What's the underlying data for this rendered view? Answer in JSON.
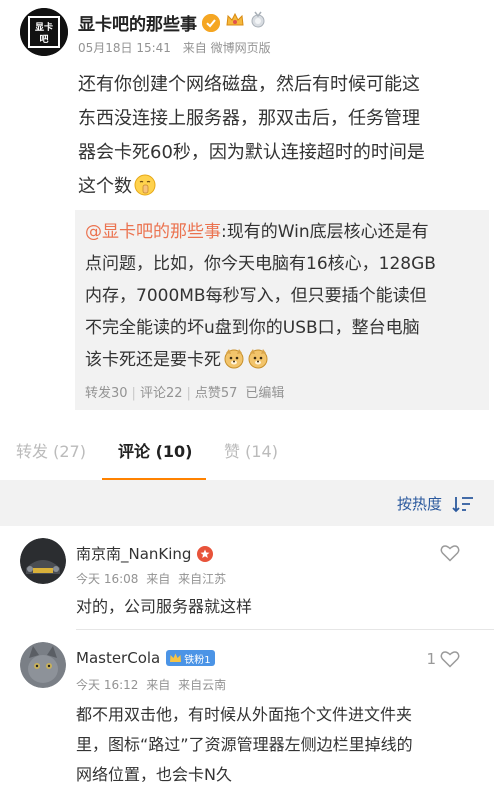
{
  "post": {
    "author": "显卡吧的那些事",
    "avatar_text": "显卡吧",
    "date": "05月18日 15:41",
    "source": "来自 微博网页版",
    "text_lines": [
      "还有你创建个网络磁盘，然后有时候可能这",
      "东西没连接上服务器，那双击后，任务管理",
      "器会卡死60秒，因为默认连接超时的时间是",
      "这个数"
    ],
    "emoji": "shh-emoji"
  },
  "repost": {
    "mention": "@显卡吧的那些事",
    "text_lines": [
      ":现有的Win底层核心还是有",
      "点问题，比如，你今天电脑有16核心，128GB",
      "内存，7000MB每秒写入，但只要插个能读但",
      "不完全能读的坏u盘到你的USB口，整台电脑",
      "该卡死还是要卡死"
    ],
    "forward": "转发30",
    "comments": "评论22",
    "likes": "点赞57",
    "edited": "已编辑"
  },
  "tabs": [
    {
      "label": "转发 (27)"
    },
    {
      "label": "评论 (10)"
    },
    {
      "label": "赞 (14)"
    }
  ],
  "sort": {
    "label": "按热度"
  },
  "comments": [
    {
      "name": "南京南_NanKing",
      "time": "今天 16:08",
      "via": "来自",
      "location": "来自江苏",
      "text": "对的，公司服务器就这样",
      "likes": ""
    },
    {
      "name": "MasterCola",
      "fan_badge": "铁粉1",
      "time": "今天 16:12",
      "via": "来自",
      "location": "来自云南",
      "text_lines": [
        "都不用双击他，有时候从外面拖个文件进文件夹",
        "里，图标“路过”了资源管理器左侧边栏里掉线的",
        "网络位置，也会卡N久"
      ],
      "likes": "1"
    }
  ],
  "colors": {
    "accent_orange": "#ff8200",
    "link_blue": "#2c5a9e",
    "mention_orange": "#eb7350",
    "fan_badge_blue": "#4b94e6"
  }
}
